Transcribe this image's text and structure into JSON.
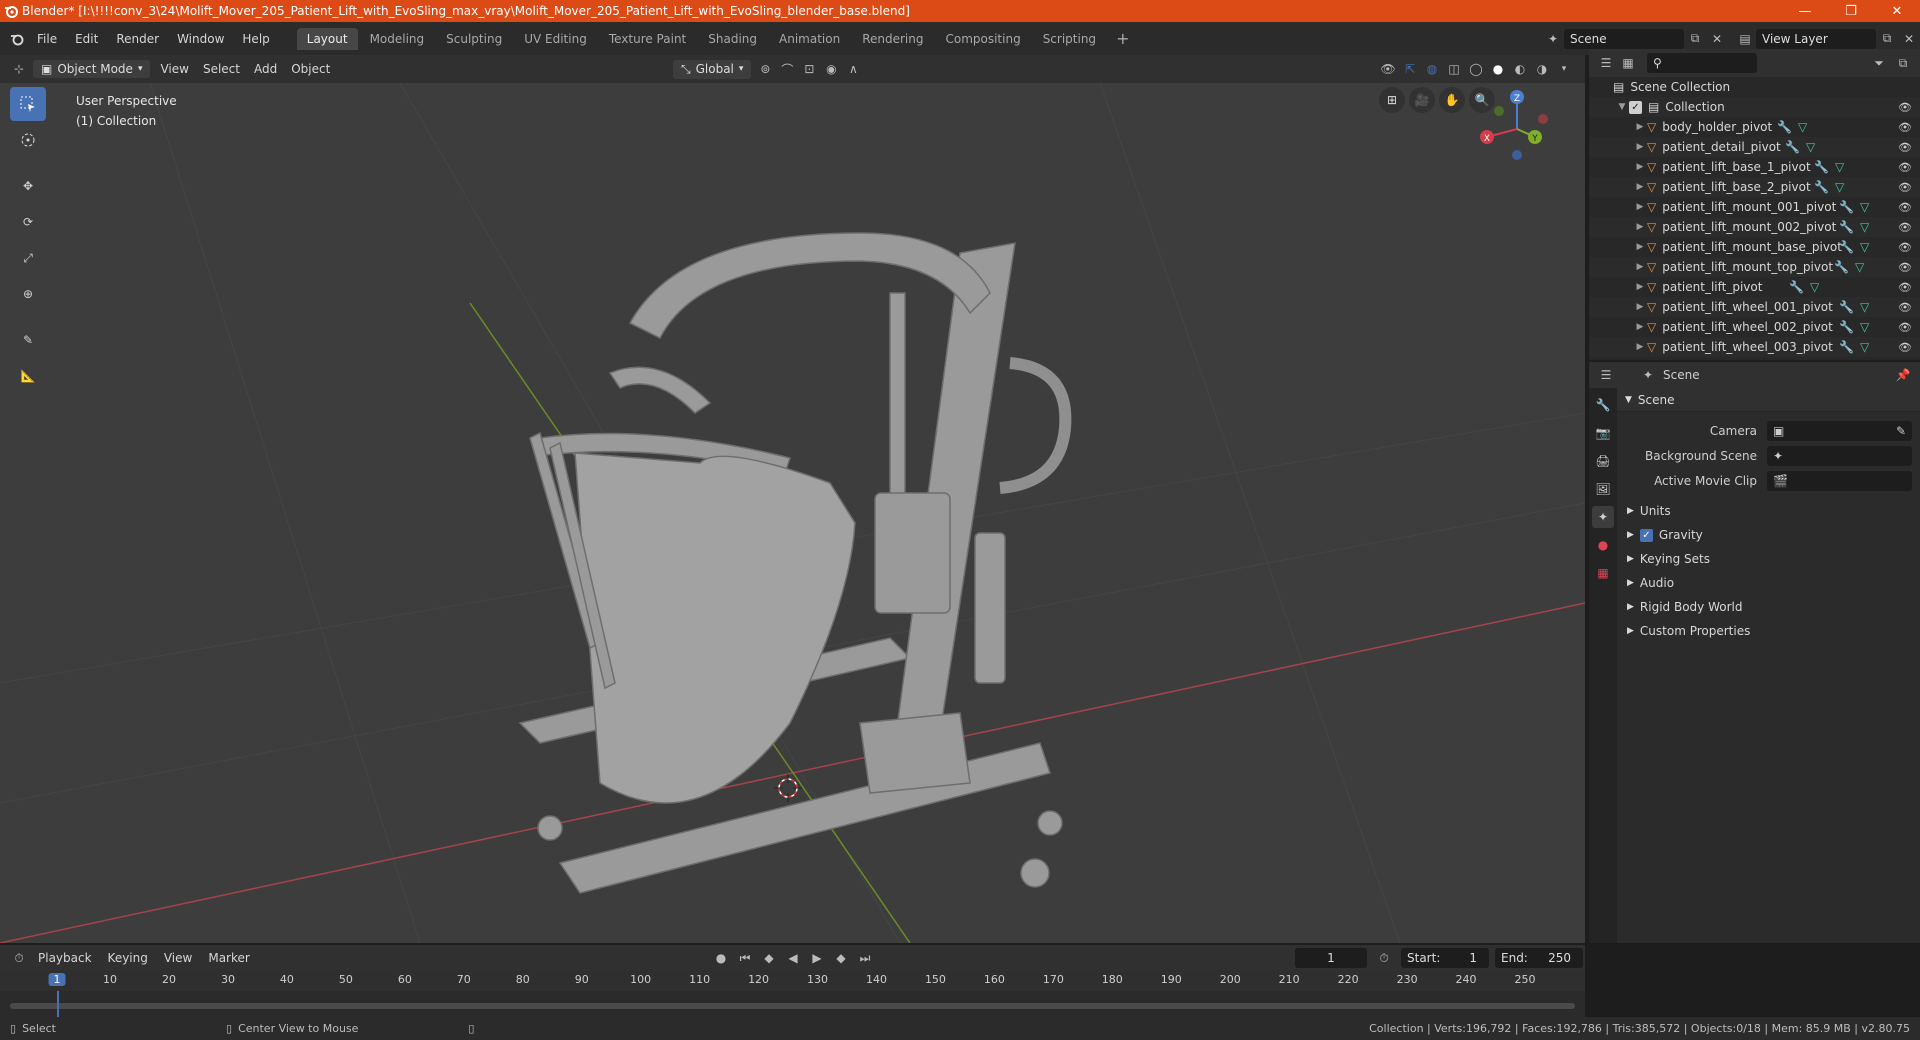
{
  "window": {
    "title": "Blender* [I:\\!!!!conv_3\\24\\Molift_Mover_205_Patient_Lift_with_EvoSling_max_vray\\Molift_Mover_205_Patient_Lift_with_EvoSling_blender_base.blend]",
    "minimize": "—",
    "restore": "❐",
    "close": "✕"
  },
  "menu": [
    "File",
    "Edit",
    "Render",
    "Window",
    "Help"
  ],
  "workspaces": {
    "active": "Layout",
    "tabs": [
      "Layout",
      "Modeling",
      "Sculpting",
      "UV Editing",
      "Texture Paint",
      "Shading",
      "Animation",
      "Rendering",
      "Compositing",
      "Scripting"
    ],
    "add": "+"
  },
  "scene_selector": "Scene",
  "view_layer": "View Layer",
  "viewport_header": {
    "mode": "Object Mode",
    "menus": [
      "View",
      "Select",
      "Add",
      "Object"
    ],
    "orientation": "Global"
  },
  "viewport": {
    "perspective": "User Perspective",
    "collection": "(1) Collection",
    "gizmo": {
      "x": "X",
      "y": "Y",
      "z": "Z"
    }
  },
  "outliner": {
    "root": "Scene Collection",
    "collection": "Collection",
    "objects": [
      "body_holder_pivot",
      "patient_detail_pivot",
      "patient_lift_base_1_pivot",
      "patient_lift_base_2_pivot",
      "patient_lift_mount_001_pivot",
      "patient_lift_mount_002_pivot",
      "patient_lift_mount_base_pivot",
      "patient_lift_mount_top_pivot",
      "patient_lift_pivot",
      "patient_lift_wheel_001_pivot",
      "patient_lift_wheel_002_pivot",
      "patient_lift_wheel_003_pivot"
    ]
  },
  "properties": {
    "context": "Scene",
    "panel": "Scene",
    "camera_label": "Camera",
    "background_scene_label": "Background Scene",
    "active_movie_clip_label": "Active Movie Clip",
    "sections": [
      "Units",
      "Gravity",
      "Keying Sets",
      "Audio",
      "Rigid Body World",
      "Custom Properties"
    ]
  },
  "timeline": {
    "menus": [
      "Playback",
      "Keying",
      "View",
      "Marker"
    ],
    "current_frame": "1",
    "start_label": "Start:",
    "start": "1",
    "end_label": "End:",
    "end": "250",
    "ticks": [
      "1",
      "10",
      "20",
      "30",
      "40",
      "50",
      "60",
      "70",
      "80",
      "90",
      "100",
      "110",
      "120",
      "130",
      "140",
      "150",
      "160",
      "170",
      "180",
      "190",
      "200",
      "210",
      "220",
      "230",
      "240",
      "250"
    ]
  },
  "statusbar": {
    "select": "Select",
    "center_view": "Center View to Mouse",
    "stats": "Collection | Verts:196,792 | Faces:192,786 | Tris:385,572 | Objects:0/18 | Mem: 85.9 MB | v2.80.75"
  }
}
